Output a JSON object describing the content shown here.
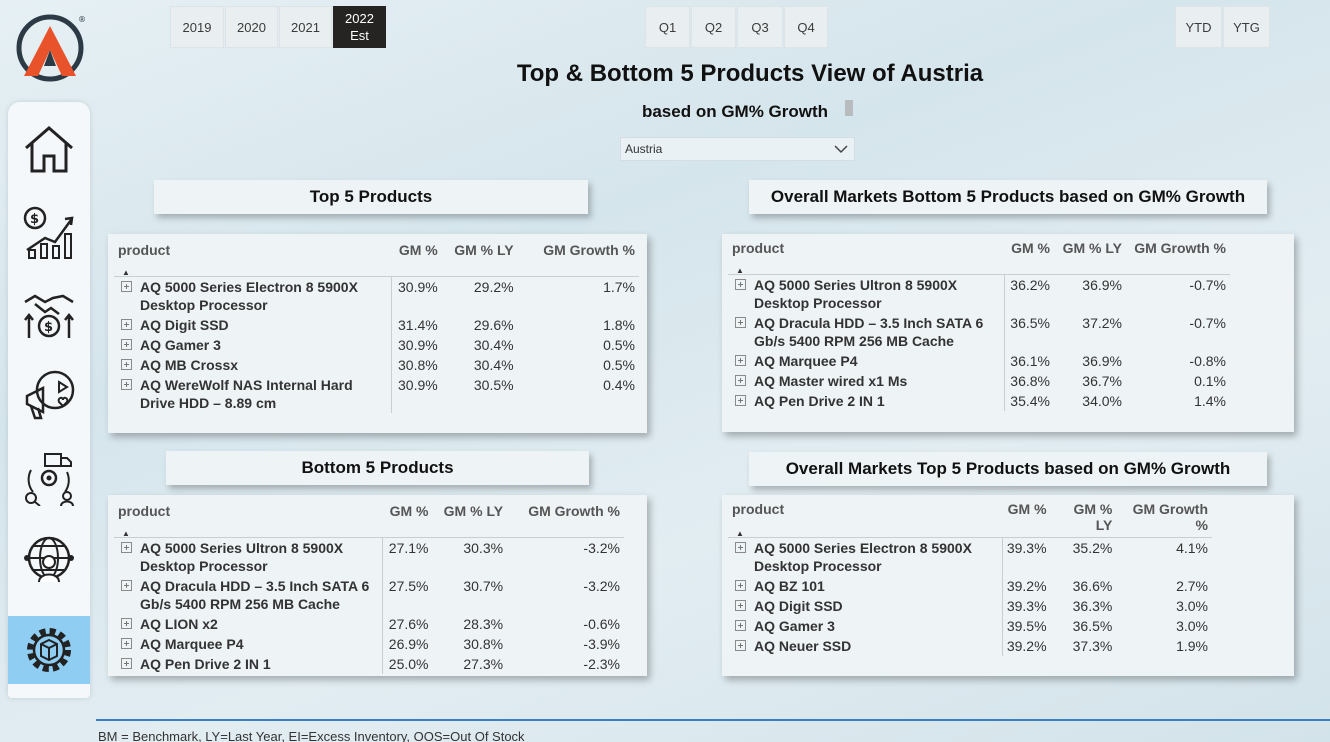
{
  "header": {
    "title": "Top & Bottom 5 Products View of Austria",
    "subtitle": "based on GM% Growth",
    "market_dropdown_value": "Austria"
  },
  "year_buttons": [
    {
      "label": "2019"
    },
    {
      "label": "2020"
    },
    {
      "label": "2021"
    },
    {
      "label": "2022 Est",
      "line1": "2022",
      "line2": "Est",
      "selected": true
    }
  ],
  "quarter_buttons": [
    {
      "label": "Q1"
    },
    {
      "label": "Q2"
    },
    {
      "label": "Q3"
    },
    {
      "label": "Q4"
    }
  ],
  "period_buttons": [
    {
      "label": "YTD"
    },
    {
      "label": "YTG"
    }
  ],
  "sidebar": {
    "items": [
      {
        "icon": "home-icon"
      },
      {
        "icon": "finance-growth-icon"
      },
      {
        "icon": "handshake-money-icon"
      },
      {
        "icon": "marketing-megaphone-icon"
      },
      {
        "icon": "supply-chain-icon"
      },
      {
        "icon": "global-user-icon"
      },
      {
        "icon": "settings-gear-icon",
        "active": true
      }
    ]
  },
  "columns": {
    "product": "product",
    "gm": "GM %",
    "gm_ly": "GM % LY",
    "gm_growth": "GM Growth %"
  },
  "top5": {
    "title": "Top 5 Products",
    "rows": [
      {
        "product": "AQ 5000 Series Electron 8 5900X Desktop Processor",
        "gm": "30.9%",
        "gm_ly": "29.2%",
        "growth": "1.7%"
      },
      {
        "product": "AQ Digit SSD",
        "gm": "31.4%",
        "gm_ly": "29.6%",
        "growth": "1.8%"
      },
      {
        "product": "AQ Gamer 3",
        "gm": "30.9%",
        "gm_ly": "30.4%",
        "growth": "0.5%"
      },
      {
        "product": "AQ MB Crossx",
        "gm": "30.8%",
        "gm_ly": "30.4%",
        "growth": "0.5%"
      },
      {
        "product": "AQ WereWolf NAS Internal Hard Drive HDD – 8.89 cm",
        "gm": "30.9%",
        "gm_ly": "30.5%",
        "growth": "0.4%"
      }
    ]
  },
  "bottom5": {
    "title": "Bottom 5 Products",
    "rows": [
      {
        "product": "AQ 5000 Series Ultron 8 5900X Desktop Processor",
        "gm": "27.1%",
        "gm_ly": "30.3%",
        "growth": "-3.2%"
      },
      {
        "product": "AQ Dracula HDD – 3.5 Inch SATA 6 Gb/s 5400 RPM 256 MB Cache",
        "gm": "27.5%",
        "gm_ly": "30.7%",
        "growth": "-3.2%"
      },
      {
        "product": "AQ LION x2",
        "gm": "27.6%",
        "gm_ly": "28.3%",
        "growth": "-0.6%"
      },
      {
        "product": "AQ Marquee P4",
        "gm": "26.9%",
        "gm_ly": "30.8%",
        "growth": "-3.9%"
      },
      {
        "product": "AQ Pen Drive 2 IN 1",
        "gm": "25.0%",
        "gm_ly": "27.3%",
        "growth": "-2.3%"
      }
    ]
  },
  "overall_bottom5": {
    "title": "Overall Markets Bottom 5 Products based on GM% Growth",
    "rows": [
      {
        "product": "AQ 5000 Series Ultron 8 5900X Desktop Processor",
        "gm": "36.2%",
        "gm_ly": "36.9%",
        "growth": "-0.7%"
      },
      {
        "product": "AQ Dracula HDD – 3.5 Inch SATA 6 Gb/s 5400 RPM 256 MB Cache",
        "gm": "36.5%",
        "gm_ly": "37.2%",
        "growth": "-0.7%"
      },
      {
        "product": "AQ Marquee P4",
        "gm": "36.1%",
        "gm_ly": "36.9%",
        "growth": "-0.8%"
      },
      {
        "product": "AQ Master wired x1 Ms",
        "gm": "36.8%",
        "gm_ly": "36.7%",
        "growth": "0.1%"
      },
      {
        "product": "AQ Pen Drive 2 IN 1",
        "gm": "35.4%",
        "gm_ly": "34.0%",
        "growth": "1.4%"
      }
    ]
  },
  "overall_top5": {
    "title": "Overall Markets Top 5 Products based on GM% Growth",
    "rows": [
      {
        "product": "AQ 5000 Series Electron 8 5900X Desktop Processor",
        "gm": "39.3%",
        "gm_ly": "35.2%",
        "growth": "4.1%"
      },
      {
        "product": "AQ BZ 101",
        "gm": "39.2%",
        "gm_ly": "36.6%",
        "growth": "2.7%"
      },
      {
        "product": "AQ Digit SSD",
        "gm": "39.3%",
        "gm_ly": "36.3%",
        "growth": "3.0%"
      },
      {
        "product": "AQ Gamer 3",
        "gm": "39.5%",
        "gm_ly": "36.5%",
        "growth": "3.0%"
      },
      {
        "product": "AQ Neuer SSD",
        "gm": "39.2%",
        "gm_ly": "37.3%",
        "growth": "1.9%"
      }
    ]
  },
  "footer": {
    "text": "BM = Benchmark, LY=Last Year, EI=Excess Inventory, OOS=Out Of Stock"
  },
  "colors": {
    "accent_blue": "#3a7fc0",
    "active_nav": "#8fcdf2",
    "selected_button": "#252423",
    "logo_orange": "#e8532b",
    "logo_dark": "#2b3a44"
  }
}
